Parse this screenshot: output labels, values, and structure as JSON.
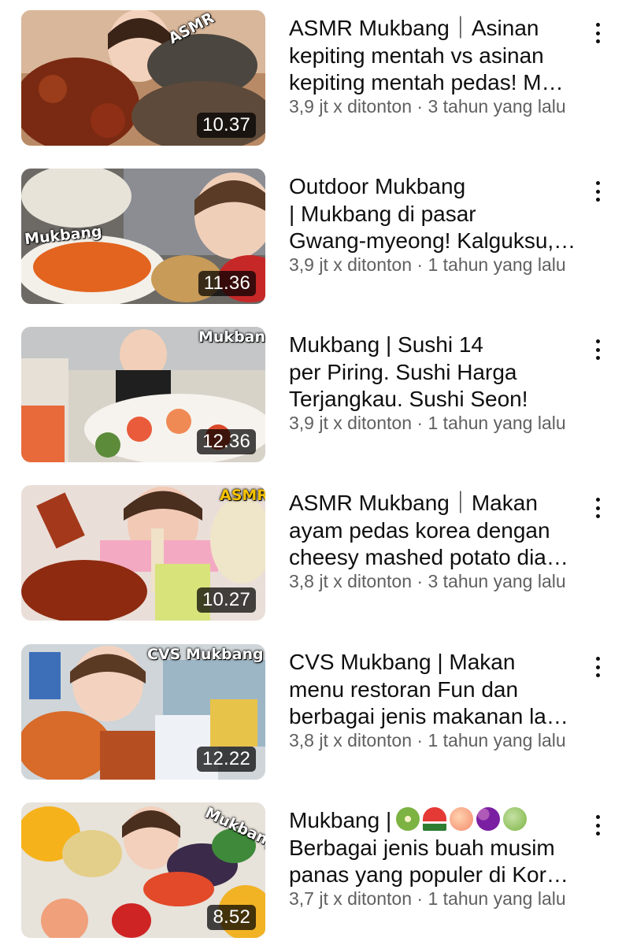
{
  "videos": [
    {
      "title_lines": [
        "ASMR Mukbang｜Asinan",
        "kepiting mentah vs asinan",
        "kepiting mentah pedas! M…"
      ],
      "duration": "10.37",
      "views": "3,9 jt x ditonton",
      "age": "3 tahun yang lalu",
      "badge": "ASMR"
    },
    {
      "title_lines": [
        "Outdoor Mukbang",
        "| Mukbang di pasar",
        "Gwang-myeong! Kalguksu,…"
      ],
      "duration": "11.36",
      "views": "3,9 jt x ditonton",
      "age": "1 tahun yang lalu",
      "badge": "Mukbang"
    },
    {
      "title_lines": [
        "Mukbang | Sushi 14",
        "per Piring. Sushi Harga",
        "Terjangkau. Sushi Seon!"
      ],
      "duration": "12.36",
      "views": "3,9 jt x ditonton",
      "age": "1 tahun yang lalu",
      "badge": "Mukbang"
    },
    {
      "title_lines": [
        "ASMR Mukbang｜Makan",
        "ayam pedas korea dengan",
        "cheesy mashed potato dia…"
      ],
      "duration": "10.27",
      "views": "3,8 jt x ditonton",
      "age": "3 tahun yang lalu",
      "badge": "ASMR"
    },
    {
      "title_lines": [
        "CVS Mukbang | Makan",
        "menu restoran Fun dan",
        "berbagai jenis makanan la…"
      ],
      "duration": "12.22",
      "views": "3,8 jt x ditonton",
      "age": "1 tahun yang lalu",
      "badge": "CVS Mukbang"
    },
    {
      "title_lines": [
        "Mukbang |",
        "Berbagai jenis buah musim",
        "panas yang populer di Kor…"
      ],
      "title_emoji": [
        "kiwi",
        "watermelon",
        "peach",
        "grapes",
        "melon"
      ],
      "duration": "8.52",
      "views": "3,7 jt x ditonton",
      "age": "1 tahun yang lalu",
      "badge": "Mukbang"
    }
  ],
  "separator": " · ",
  "colors": {
    "meta": "#606060",
    "title": "#0f0f0f",
    "duration_bg": "#000000"
  }
}
